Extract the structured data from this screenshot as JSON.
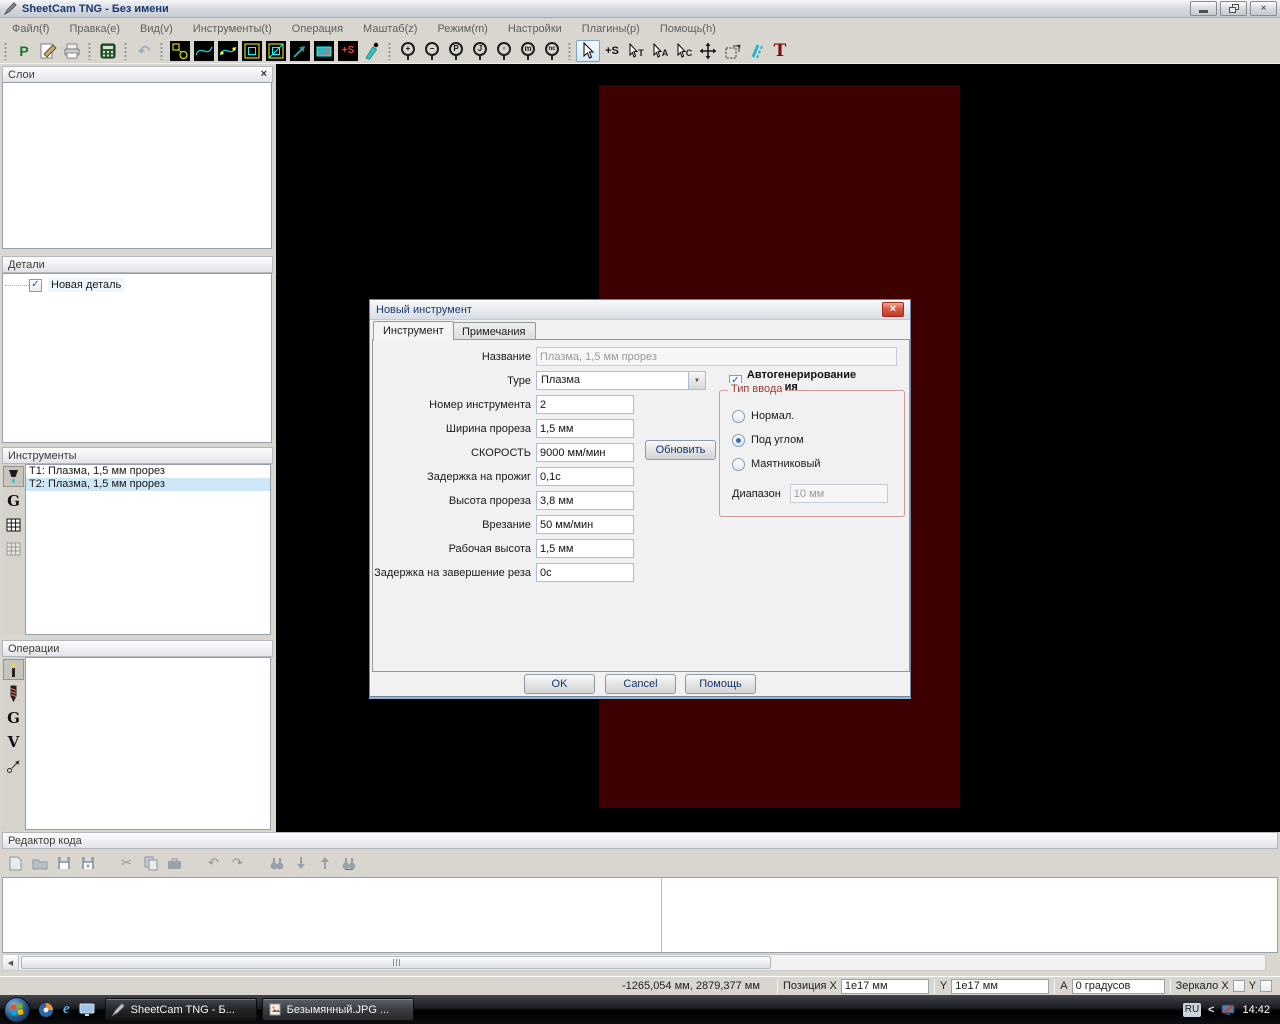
{
  "window": {
    "title": "SheetCam TNG - Без имени"
  },
  "menu": {
    "items": [
      "Файл(f)",
      "Правка(e)",
      "Вид(v)",
      "Инструменты(t)",
      "Операция",
      "Маштаб(z)",
      "Режим(m)",
      "Настройки",
      "Плагины(p)",
      "Помощь(h)"
    ]
  },
  "sidebar": {
    "layers": {
      "title": "Слои"
    },
    "parts": {
      "title": "Детали",
      "item_label": "Новая деталь"
    },
    "tools": {
      "title": "Инструменты",
      "items": [
        {
          "label": "T1: Плазма, 1,5 мм прорез"
        },
        {
          "label": "T2: Плазма, 1,5 мм прорез"
        }
      ]
    },
    "operations": {
      "title": "Операции"
    }
  },
  "dialog": {
    "title": "Новый инструмент",
    "tabs": [
      {
        "label": "Инструмент"
      },
      {
        "label": "Примечания"
      }
    ],
    "fields": [
      {
        "label": "Название",
        "value": "Плазма, 1,5 мм прорез"
      },
      {
        "label": "Type",
        "value": "Плазма"
      },
      {
        "label": "Номер инструмента",
        "value": "2"
      },
      {
        "label": "Ширина прореза",
        "value": "1,5 мм"
      },
      {
        "label": "СКОРОСТЬ",
        "value": "9000 мм/мин"
      },
      {
        "label": "Задержка на прожиг",
        "value": "0,1с"
      },
      {
        "label": "Высота прореза",
        "value": "3,8 мм"
      },
      {
        "label": "Врезание",
        "value": "50 мм/мин"
      },
      {
        "label": "Рабочая высота",
        "value": "1,5 мм"
      },
      {
        "label": "Задержка на завершение реза",
        "value": "0с"
      }
    ],
    "update_button": "Обновить",
    "autogen_label": "Автогенерирование названия",
    "input_type_group": {
      "title": "Тип ввода",
      "options": [
        {
          "label": "Нормал."
        },
        {
          "label": "Под углом"
        },
        {
          "label": "Маятниковый"
        }
      ],
      "selected": "Под углом",
      "range_label": "Диапазон",
      "range_value": "10 мм"
    },
    "buttons": {
      "ok": "OK",
      "cancel": "Cancel",
      "help": "Помощь"
    }
  },
  "code_editor": {
    "title": "Редактор кода"
  },
  "status_bar": {
    "coords": "-1265,054 мм, 2879,377 мм",
    "position_label": "Позиция X",
    "x_value": "1e17 мм",
    "y_label": "Y",
    "y_value": "1e17 мм",
    "angle_label": "А",
    "angle_value": "0 градусов",
    "mirror_x_label": "Зеркало X",
    "mirror_y_label": "Y"
  },
  "taskbar": {
    "tasks": [
      {
        "label": "SheetCam TNG - Б..."
      },
      {
        "label": "Безымянный.JPG ..."
      }
    ],
    "tray": {
      "lang": "RU",
      "time": "14:42"
    }
  },
  "icons": {
    "close": "×",
    "check": "✓",
    "dropdown": "▼",
    "undo": "↶",
    "redo": "↷",
    "cut": "✂",
    "scroll_left": "◀",
    "post_process": "P",
    "plus_s": "+S",
    "letter_t": "T",
    "letter_a": "A",
    "letter_c": "C",
    "letter_g": "G",
    "letter_v": "V",
    "red_t": "T",
    "zoom_plus": "+",
    "zoom_minus": "−",
    "zoom_p": "P",
    "zoom_j": "J",
    "zoom_rect": "▫",
    "zoom_m": "m",
    "zoom_nc": "nc",
    "tray_collapse": "<",
    "ie": "e"
  },
  "colors": {
    "canvas": "#000000",
    "sheet": "#3e0101",
    "selection": "#cfe8f7",
    "group_label": "#9c3a38"
  }
}
